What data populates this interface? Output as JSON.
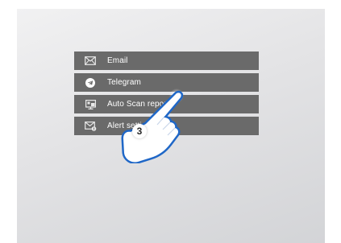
{
  "menu": {
    "items": [
      {
        "label": "Email",
        "icon": "envelope-icon"
      },
      {
        "label": "Telegram",
        "icon": "telegram-icon"
      },
      {
        "label": "Auto Scan reports",
        "icon": "report-icon"
      },
      {
        "label": "Alert settings",
        "icon": "alert-envelope-icon"
      }
    ]
  },
  "tutorial": {
    "step": "3",
    "pointer": "hand-pointer-icon"
  },
  "colors": {
    "menu_bg": "#6a6a6a",
    "menu_text": "#ffffff",
    "panel_bg": "#e6e6e8"
  }
}
